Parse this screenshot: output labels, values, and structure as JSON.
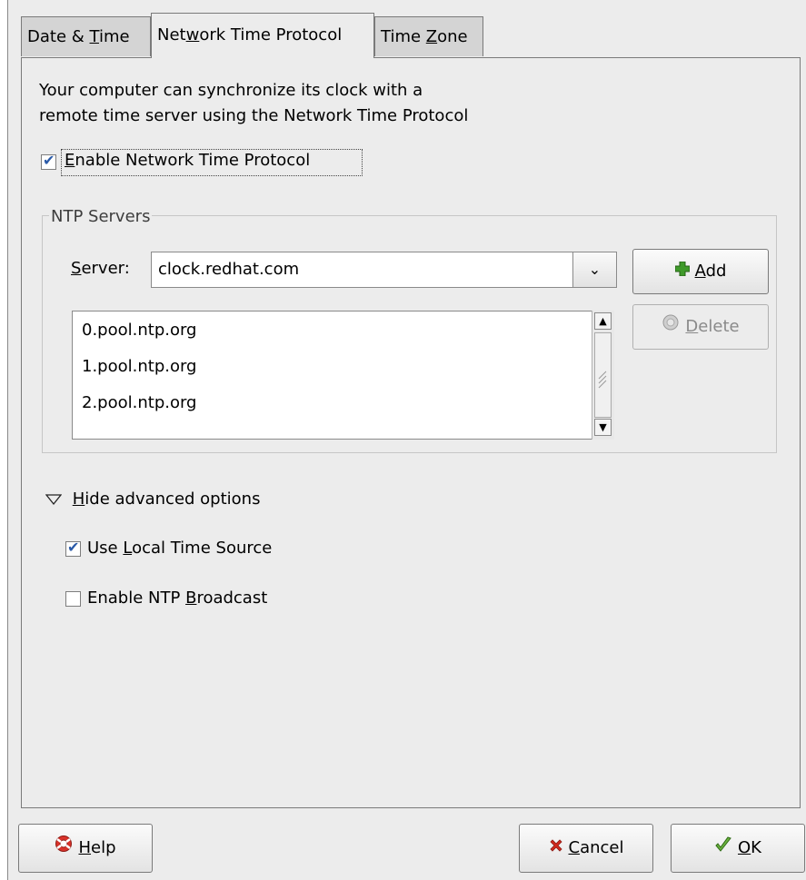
{
  "tabs": [
    {
      "label_pre": "Date & ",
      "label_mn": "T",
      "label_post": "ime"
    },
    {
      "label_pre": "Net",
      "label_mn": "w",
      "label_post": "ork Time Protocol"
    },
    {
      "label_pre": "Time ",
      "label_mn": "Z",
      "label_post": "one"
    }
  ],
  "description": {
    "line1": "Your computer can synchronize its clock with a",
    "line2": "remote time server using the Network Time Protocol"
  },
  "enable_ntp": {
    "mn": "E",
    "rest": "nable Network Time Protocol",
    "checked": true
  },
  "ntp_servers": {
    "frame_label": "NTP Servers",
    "server_label_mn": "S",
    "server_label_rest": "erver:",
    "server_value": "clock.redhat.com",
    "list": [
      "0.pool.ntp.org",
      "1.pool.ntp.org",
      "2.pool.ntp.org"
    ],
    "add_mn": "A",
    "add_rest": "dd",
    "delete_mn": "D",
    "delete_rest": "elete"
  },
  "advanced": {
    "toggle_mn": "H",
    "toggle_rest": "ide advanced options",
    "local_pre": "Use ",
    "local_mn": "L",
    "local_rest": "ocal Time Source",
    "local_checked": true,
    "broadcast_pre": "Enable NTP ",
    "broadcast_mn": "B",
    "broadcast_rest": "roadcast",
    "broadcast_checked": false
  },
  "footer": {
    "help_mn": "H",
    "help_rest": "elp",
    "cancel_mn": "C",
    "cancel_rest": "ancel",
    "ok_mn": "O",
    "ok_rest": "K"
  },
  "colors": {
    "add_icon": "#3f9a2a",
    "cancel_icon": "#d2281c",
    "ok_icon": "#4a9a2a",
    "check": "#2a5aa8"
  }
}
